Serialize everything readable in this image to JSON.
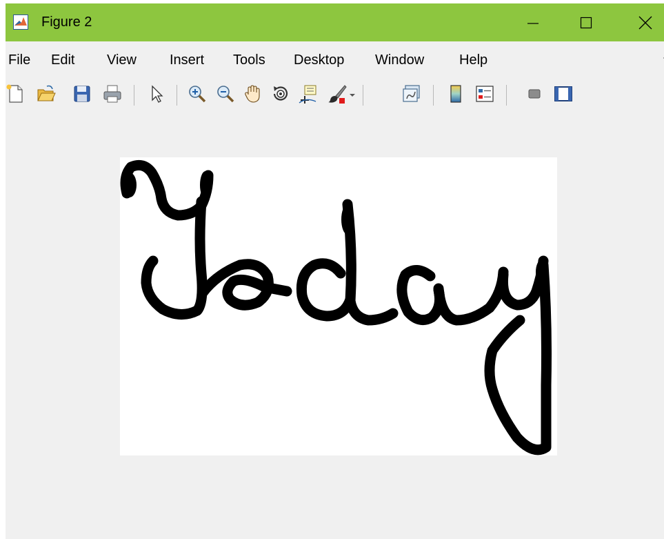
{
  "window": {
    "title": "Figure 2",
    "titlebar_color": "#8dc63f",
    "app_icon": "matlab-icon",
    "controls": [
      "minimize-icon",
      "maximize-icon",
      "close-icon"
    ]
  },
  "menu": {
    "items": [
      "File",
      "Edit",
      "View",
      "Insert",
      "Tools",
      "Desktop",
      "Window",
      "Help"
    ]
  },
  "toolbar": {
    "buttons": [
      "new-figure-icon",
      "open-file-icon",
      "save-icon",
      "print-icon",
      "arrow-pointer-icon",
      "zoom-in-icon",
      "zoom-out-icon",
      "pan-hand-icon",
      "rotate-3d-icon",
      "data-cursor-icon",
      "brush-icon",
      "dropdown-arrow-icon",
      "link-plot-icon",
      "colorbar-icon",
      "legend-icon",
      "hide-plot-tools-icon",
      "show-plot-tools-icon"
    ]
  },
  "figure": {
    "image_content": "handwritten-word-image",
    "handwritten_word": "Today",
    "background": "#ffffff",
    "ink": "#000000"
  }
}
